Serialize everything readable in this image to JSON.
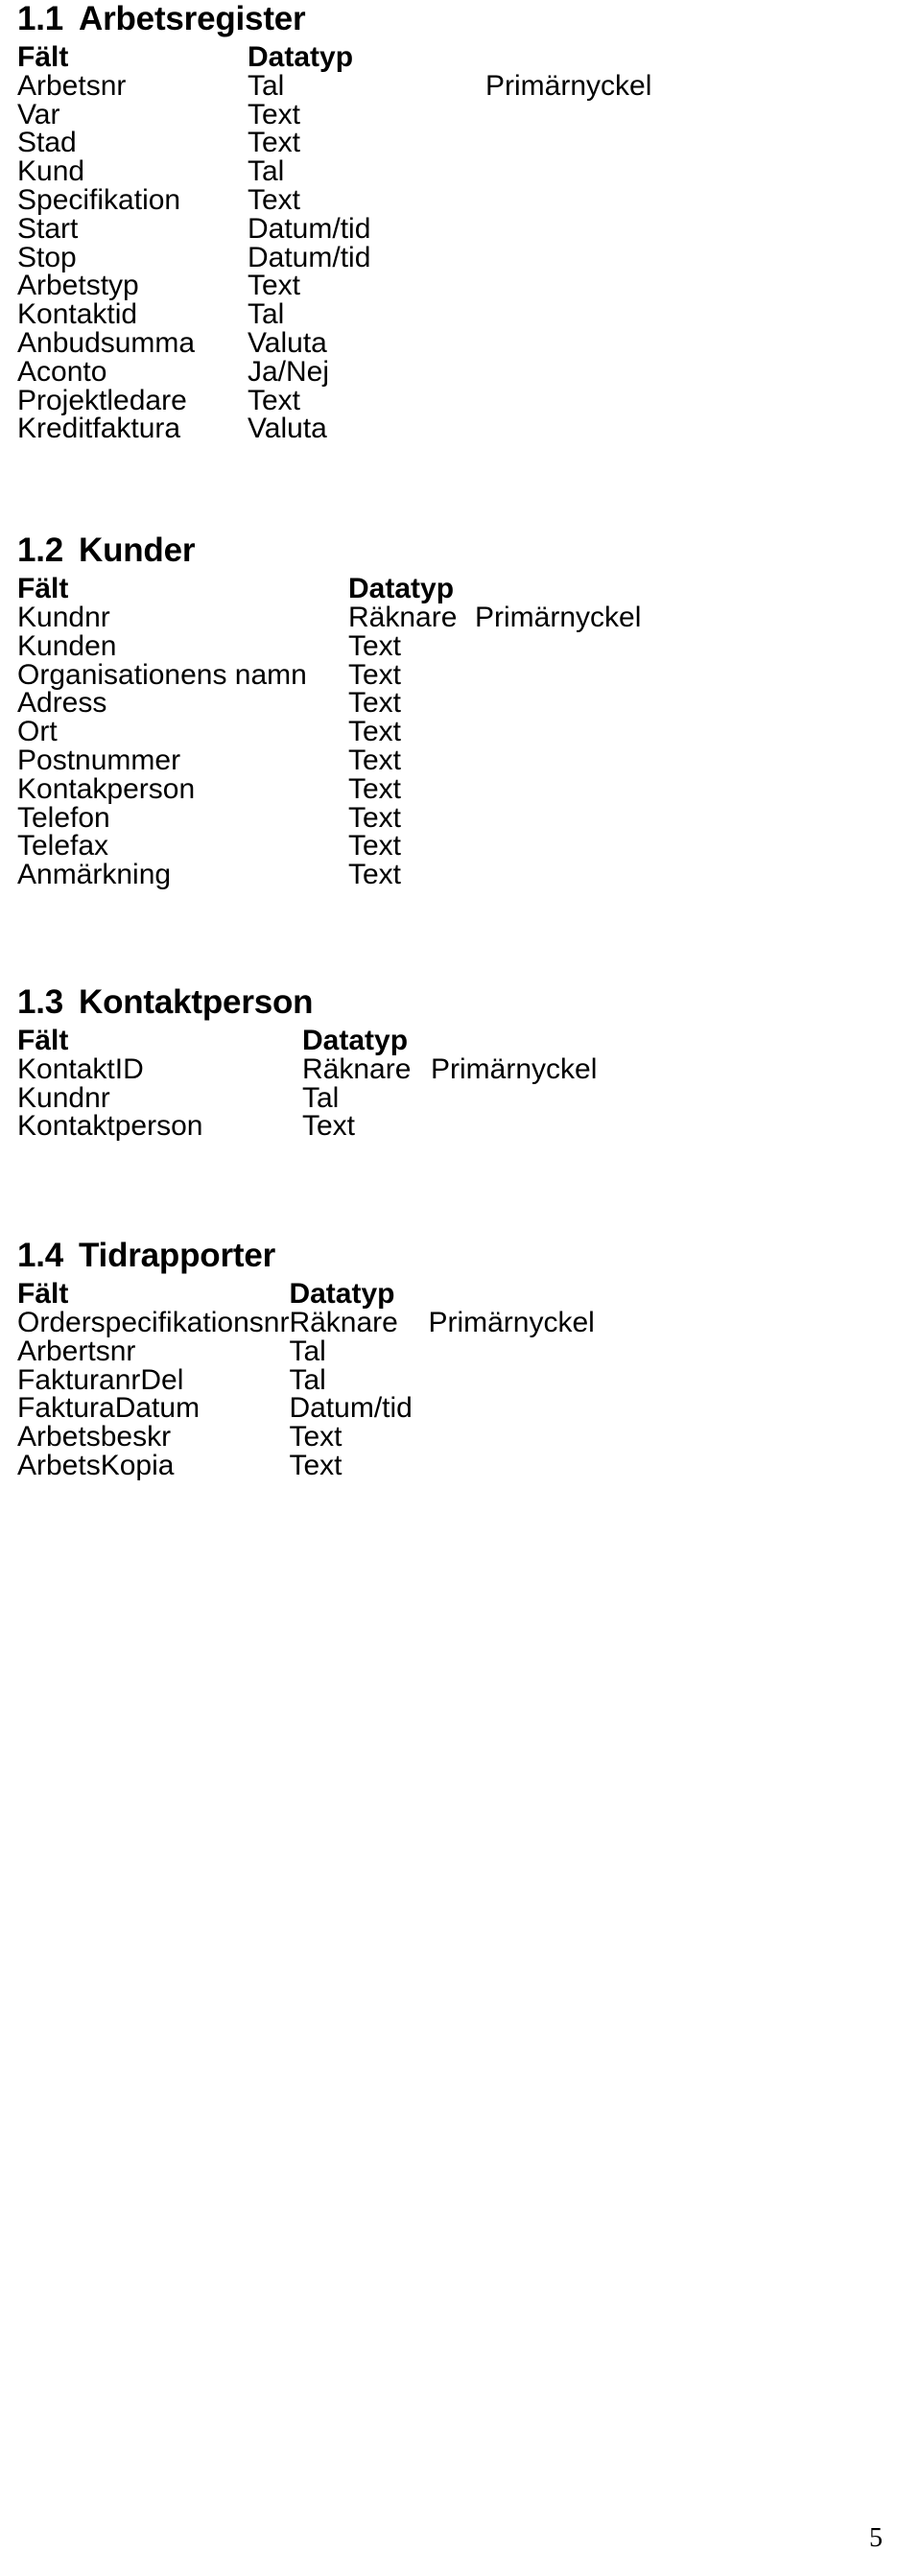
{
  "document": {
    "page_number": "5"
  },
  "sections": [
    {
      "number": "1.1",
      "title": "Arbetsregister",
      "headers": {
        "field": "Fält",
        "datatype": "Datatyp",
        "key": ""
      },
      "rows": [
        {
          "field": "Arbetsnr",
          "datatype": "Tal",
          "key": "Primärnyckel"
        },
        {
          "field": "Var",
          "datatype": "Text",
          "key": ""
        },
        {
          "field": "Stad",
          "datatype": "Text",
          "key": ""
        },
        {
          "field": "Kund",
          "datatype": "Tal",
          "key": ""
        },
        {
          "field": "Specifikation",
          "datatype": "Text",
          "key": ""
        },
        {
          "field": "Start",
          "datatype": "Datum/tid",
          "key": ""
        },
        {
          "field": "Stop",
          "datatype": "Datum/tid",
          "key": ""
        },
        {
          "field": "Arbetstyp",
          "datatype": "Text",
          "key": ""
        },
        {
          "field": "Kontaktid",
          "datatype": "Tal",
          "key": ""
        },
        {
          "field": "Anbudsumma",
          "datatype": "Valuta",
          "key": ""
        },
        {
          "field": "Aconto",
          "datatype": "Ja/Nej",
          "key": ""
        },
        {
          "field": "Projektledare",
          "datatype": "Text",
          "key": ""
        },
        {
          "field": "Kreditfaktura",
          "datatype": "Valuta",
          "key": ""
        }
      ]
    },
    {
      "number": "1.2",
      "title": "Kunder",
      "headers": {
        "field": "Fält",
        "datatype": "Datatyp",
        "key": ""
      },
      "rows": [
        {
          "field": "Kundnr",
          "datatype": "Räknare",
          "key": "Primärnyckel"
        },
        {
          "field": "Kunden",
          "datatype": "Text",
          "key": ""
        },
        {
          "field": "Organisationens namn",
          "datatype": "Text",
          "key": ""
        },
        {
          "field": "Adress",
          "datatype": "Text",
          "key": ""
        },
        {
          "field": "Ort",
          "datatype": "Text",
          "key": ""
        },
        {
          "field": "Postnummer",
          "datatype": "Text",
          "key": ""
        },
        {
          "field": "Kontakperson",
          "datatype": "Text",
          "key": ""
        },
        {
          "field": "Telefon",
          "datatype": "Text",
          "key": ""
        },
        {
          "field": "Telefax",
          "datatype": "Text",
          "key": ""
        },
        {
          "field": "Anmärkning",
          "datatype": "Text",
          "key": ""
        }
      ]
    },
    {
      "number": "1.3",
      "title": "Kontaktperson",
      "headers": {
        "field": "Fält",
        "datatype": "Datatyp",
        "key": ""
      },
      "rows": [
        {
          "field": "KontaktID",
          "datatype": "Räknare",
          "key": "Primärnyckel"
        },
        {
          "field": "Kundnr",
          "datatype": "Tal",
          "key": ""
        },
        {
          "field": "Kontaktperson",
          "datatype": "Text",
          "key": ""
        }
      ]
    },
    {
      "number": "1.4",
      "title": "Tidrapporter",
      "headers": {
        "field": "Fält",
        "datatype": "Datatyp",
        "key": ""
      },
      "rows": [
        {
          "field": "Orderspecifikationsnr",
          "datatype": "Räknare",
          "key": "Primärnyckel"
        },
        {
          "field": "Arbertsnr",
          "datatype": "Tal",
          "key": ""
        },
        {
          "field": "FakturanrDel",
          "datatype": "Tal",
          "key": ""
        },
        {
          "field": "FakturaDatum",
          "datatype": "Datum/tid",
          "key": ""
        },
        {
          "field": "Arbetsbeskr",
          "datatype": "Text",
          "key": ""
        },
        {
          "field": "ArbetsKopia",
          "datatype": "Text",
          "key": ""
        }
      ]
    }
  ]
}
